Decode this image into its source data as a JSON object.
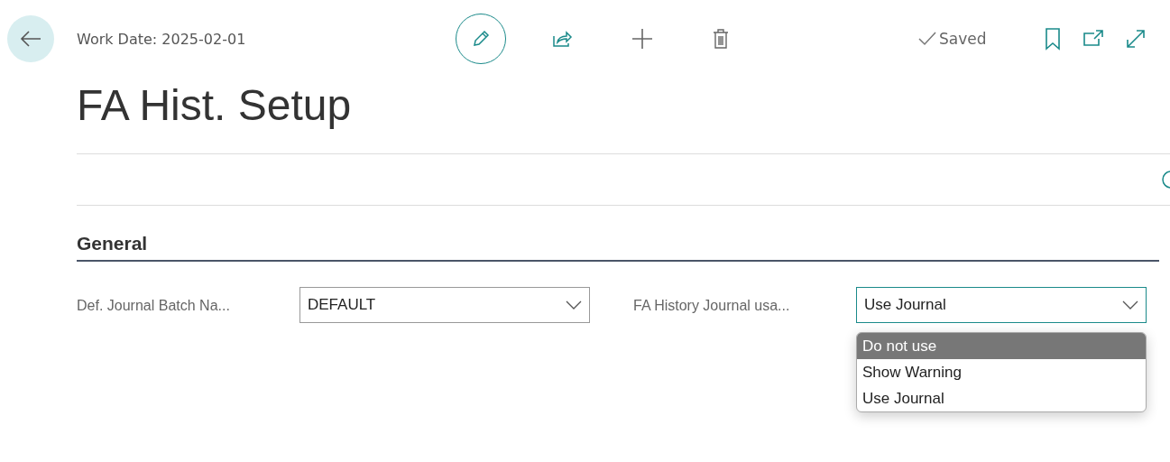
{
  "header": {
    "work_date": "Work Date: 2025-02-01",
    "status": "Saved"
  },
  "title": "FA Hist. Setup",
  "section": {
    "title": "General"
  },
  "fields": [
    {
      "label": "Def. Journal Batch Na...",
      "value": "DEFAULT",
      "focused": false
    },
    {
      "label": "FA History Journal usa...",
      "value": "Use Journal",
      "focused": true
    }
  ],
  "dropdown": {
    "options": [
      {
        "label": "Do not use",
        "selected": true
      },
      {
        "label": "Show Warning",
        "selected": false
      },
      {
        "label": "Use Journal",
        "selected": false
      }
    ]
  }
}
